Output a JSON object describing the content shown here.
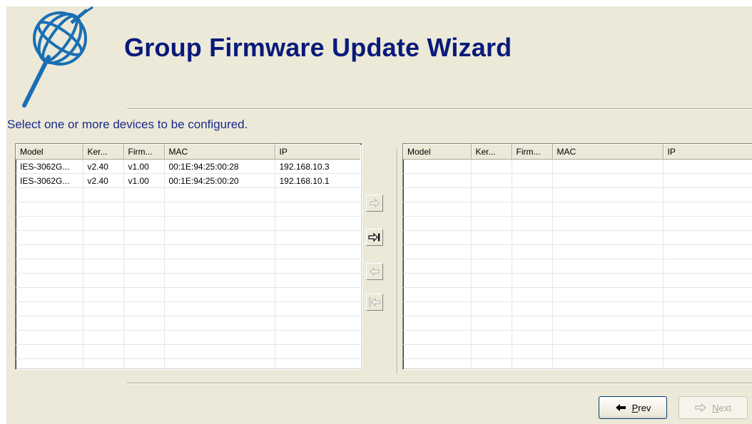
{
  "header": {
    "title": "Group Firmware Update Wizard",
    "instruction": "Select one or more devices to be configured."
  },
  "available_list": {
    "columns": [
      "Model",
      "Ker...",
      "Firm...",
      "MAC",
      "IP"
    ],
    "rows": [
      [
        "IES-3062G...",
        "v2.40",
        "v1.00",
        "00:1E:94:25:00:28",
        "192.168.10.3"
      ],
      [
        "IES-3062G...",
        "v2.40",
        "v1.00",
        "00:1E:94:25:00:20",
        "192.168.10.1"
      ]
    ]
  },
  "selected_list": {
    "columns": [
      "Model",
      "Ker...",
      "Firm...",
      "MAC",
      "IP"
    ],
    "rows": []
  },
  "transfer_buttons": {
    "add": {
      "icon": "arrow-right-icon",
      "enabled": false
    },
    "add_all": {
      "icon": "arrow-right-bar-icon",
      "enabled": true
    },
    "remove": {
      "icon": "arrow-left-icon",
      "enabled": false
    },
    "remove_all": {
      "icon": "bar-arrow-left-icon",
      "enabled": false
    }
  },
  "footer": {
    "prev": {
      "accel": "P",
      "rest": "rev",
      "icon": "arrow-left-icon",
      "enabled": true
    },
    "next": {
      "accel": "N",
      "rest": "ext",
      "icon": "arrow-right-icon",
      "enabled": false
    }
  },
  "colors": {
    "title": "#0a1a7a",
    "window_bg": "#ece9d8",
    "button_border": "#003c74"
  }
}
